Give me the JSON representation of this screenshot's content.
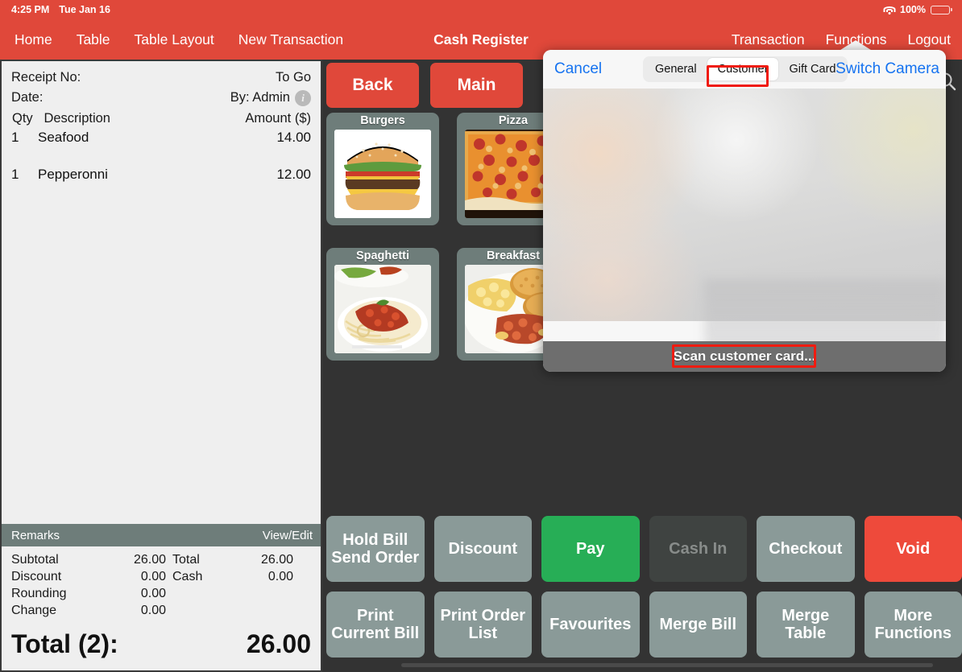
{
  "status_bar": {
    "time": "4:25 PM",
    "date": "Tue Jan 16",
    "battery_percent": "100%",
    "wifi_icon": "wifi-icon",
    "battery_icon": "battery-icon"
  },
  "navbar": {
    "title": "Cash Register",
    "left_items": [
      {
        "label": "Home"
      },
      {
        "label": "Table"
      },
      {
        "label": "Table Layout"
      },
      {
        "label": "New Transaction"
      }
    ],
    "right_items": [
      {
        "label": "Transaction"
      },
      {
        "label": "Functions"
      },
      {
        "label": "Logout"
      }
    ]
  },
  "receipt": {
    "receipt_no_label": "Receipt No:",
    "receipt_no_value": "To Go",
    "date_label": "Date:",
    "by_value": "By: Admin",
    "info_icon": "info-circle-icon",
    "columns": {
      "qty": "Qty",
      "description": "Description",
      "amount": "Amount ($)"
    },
    "items": [
      {
        "qty": "1",
        "description": "Seafood",
        "amount": "14.00"
      },
      {
        "qty": "1",
        "description": "Pepperonni",
        "amount": "12.00"
      }
    ],
    "remarks_label": "Remarks",
    "view_edit_label": "View/Edit",
    "totals": [
      {
        "label": "Subtotal",
        "value": "26.00",
        "label2": "Total",
        "value2": "26.00"
      },
      {
        "label": "Discount",
        "value": "0.00",
        "label2": "Cash",
        "value2": "0.00"
      },
      {
        "label": "Rounding",
        "value": "0.00",
        "label2": "",
        "value2": ""
      },
      {
        "label": "Change",
        "value": "0.00",
        "label2": "",
        "value2": ""
      }
    ],
    "grand_total_label": "Total (2):",
    "grand_total_value": "26.00"
  },
  "content": {
    "back_label": "Back",
    "main_label": "Main",
    "search_icon": "search-icon",
    "tiles": [
      {
        "label": "Burgers",
        "image": "burger-photo"
      },
      {
        "label": "Pizza",
        "image": "pizza-photo"
      },
      {
        "label": "Spaghetti",
        "image": "spaghetti-photo"
      },
      {
        "label": "Breakfast",
        "image": "breakfast-photo"
      }
    ],
    "actions": [
      {
        "label": "Hold Bill Send Order",
        "style": "normal"
      },
      {
        "label": "Discount",
        "style": "normal"
      },
      {
        "label": "Pay",
        "style": "green"
      },
      {
        "label": "Cash In",
        "style": "disabled"
      },
      {
        "label": "Checkout",
        "style": "normal"
      },
      {
        "label": "Void",
        "style": "red"
      },
      {
        "label": "Print Current Bill",
        "style": "normal"
      },
      {
        "label": "Print Order List",
        "style": "normal"
      },
      {
        "label": "Favourites",
        "style": "normal"
      },
      {
        "label": "Merge Bill",
        "style": "normal"
      },
      {
        "label": "Merge Table",
        "style": "normal"
      },
      {
        "label": "More Functions",
        "style": "normal"
      }
    ]
  },
  "popover": {
    "cancel_label": "Cancel",
    "switch_camera_label": "Switch Camera",
    "segments": [
      {
        "label": "General",
        "selected": false
      },
      {
        "label": "Customer",
        "selected": true
      },
      {
        "label": "Gift Card",
        "selected": false
      }
    ],
    "scan_label": "Scan customer card...",
    "accent_blue": "#1673F0",
    "highlight_color": "#F01B10"
  }
}
